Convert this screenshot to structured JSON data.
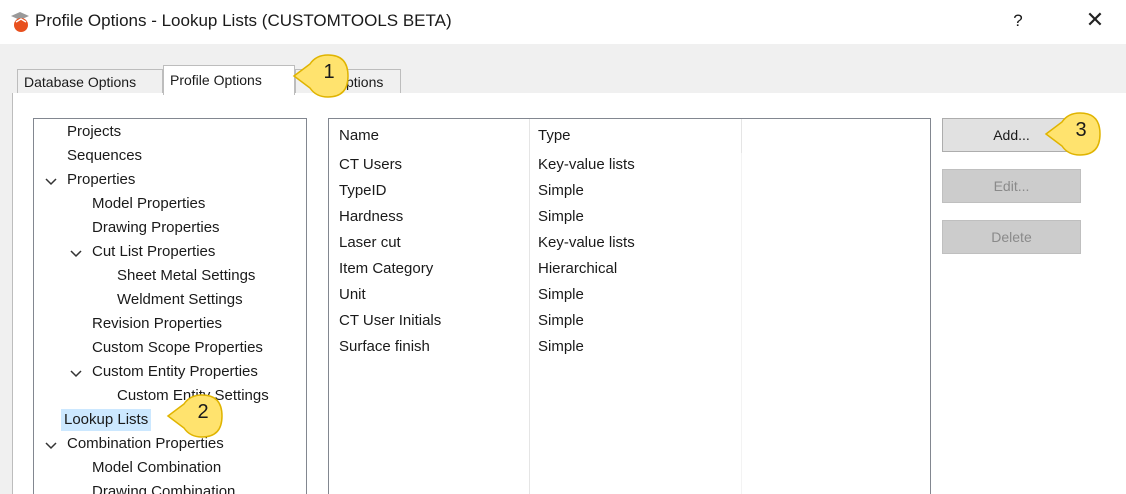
{
  "window": {
    "title": "Profile Options - Lookup Lists (CUSTOMTOOLS BETA)",
    "help_label": "?",
    "close_label": "✕",
    "icon": "app-logo-icon"
  },
  "tabs": [
    {
      "label": "Database Options"
    },
    {
      "label": "Profile Options"
    },
    {
      "label": "ptions"
    }
  ],
  "tree": {
    "items": [
      {
        "label": "Projects"
      },
      {
        "label": "Sequences"
      },
      {
        "label": "Properties"
      },
      {
        "label": "Model Properties"
      },
      {
        "label": "Drawing Properties"
      },
      {
        "label": "Cut List Properties"
      },
      {
        "label": "Sheet Metal Settings"
      },
      {
        "label": "Weldment Settings"
      },
      {
        "label": "Revision Properties"
      },
      {
        "label": "Custom Scope Properties"
      },
      {
        "label": "Custom Entity Properties"
      },
      {
        "label": "Custom Entity Settings"
      },
      {
        "label": "Lookup Lists"
      },
      {
        "label": "Combination Properties"
      },
      {
        "label": "Model Combination"
      },
      {
        "label": "Drawing Combination"
      }
    ],
    "selected": "Lookup Lists"
  },
  "list": {
    "columns": [
      "Name",
      "Type"
    ],
    "rows": [
      {
        "name": "CT Users",
        "type": "Key-value lists"
      },
      {
        "name": "TypeID",
        "type": "Simple"
      },
      {
        "name": "Hardness",
        "type": "Simple"
      },
      {
        "name": "Laser cut",
        "type": "Key-value lists"
      },
      {
        "name": "Item Category",
        "type": "Hierarchical"
      },
      {
        "name": "Unit",
        "type": "Simple"
      },
      {
        "name": "CT User Initials",
        "type": "Simple"
      },
      {
        "name": "Surface finish",
        "type": "Simple"
      }
    ]
  },
  "buttons": {
    "add": "Add...",
    "edit": "Edit...",
    "delete": "Delete"
  },
  "callouts": [
    {
      "number": "1"
    },
    {
      "number": "2"
    },
    {
      "number": "3"
    }
  ],
  "colors": {
    "callout_fill": "#ffe36e",
    "callout_stroke": "#e0b400",
    "selection": "#cce8ff",
    "logo_orange": "#e8501e"
  }
}
